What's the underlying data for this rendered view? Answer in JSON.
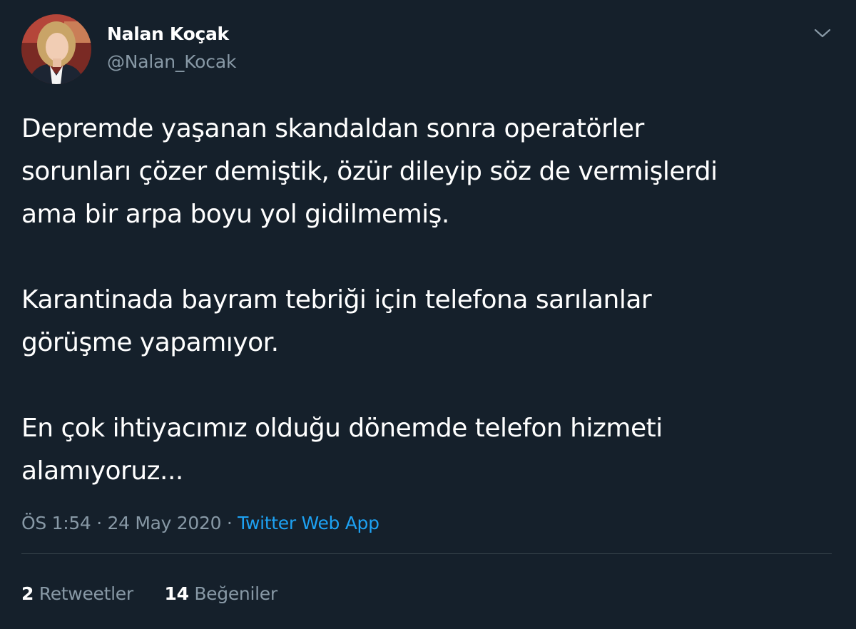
{
  "tweet": {
    "author": {
      "display_name": "Nalan Koçak",
      "handle": "@Nalan_Kocak"
    },
    "menu_icon": "chevron-down-icon",
    "paragraphs": [
      [
        "Depremde yaşanan skandaldan sonra operatörler",
        "sorunları çözer demiştik, özür dileyip söz de vermişlerdi",
        "ama bir arpa boyu yol gidilmemiş."
      ],
      [
        "Karantinada bayram tebriği için telefona sarılanlar",
        "görüşme yapamıyor."
      ],
      [
        "En çok ihtiyacımız olduğu dönemde telefon hizmeti",
        "alamıyoruz..."
      ]
    ],
    "time": "ÖS 1:54",
    "separator": " · ",
    "date": "24 May 2020",
    "source": "Twitter Web App",
    "stats": {
      "retweets_count": "2",
      "retweets_label": "Retweetler",
      "likes_count": "14",
      "likes_label": "Beğeniler"
    }
  },
  "colors": {
    "background": "#15202b",
    "text_primary": "#ffffff",
    "text_secondary": "#8899a6",
    "link": "#1da1f2",
    "divider": "#38444d"
  }
}
